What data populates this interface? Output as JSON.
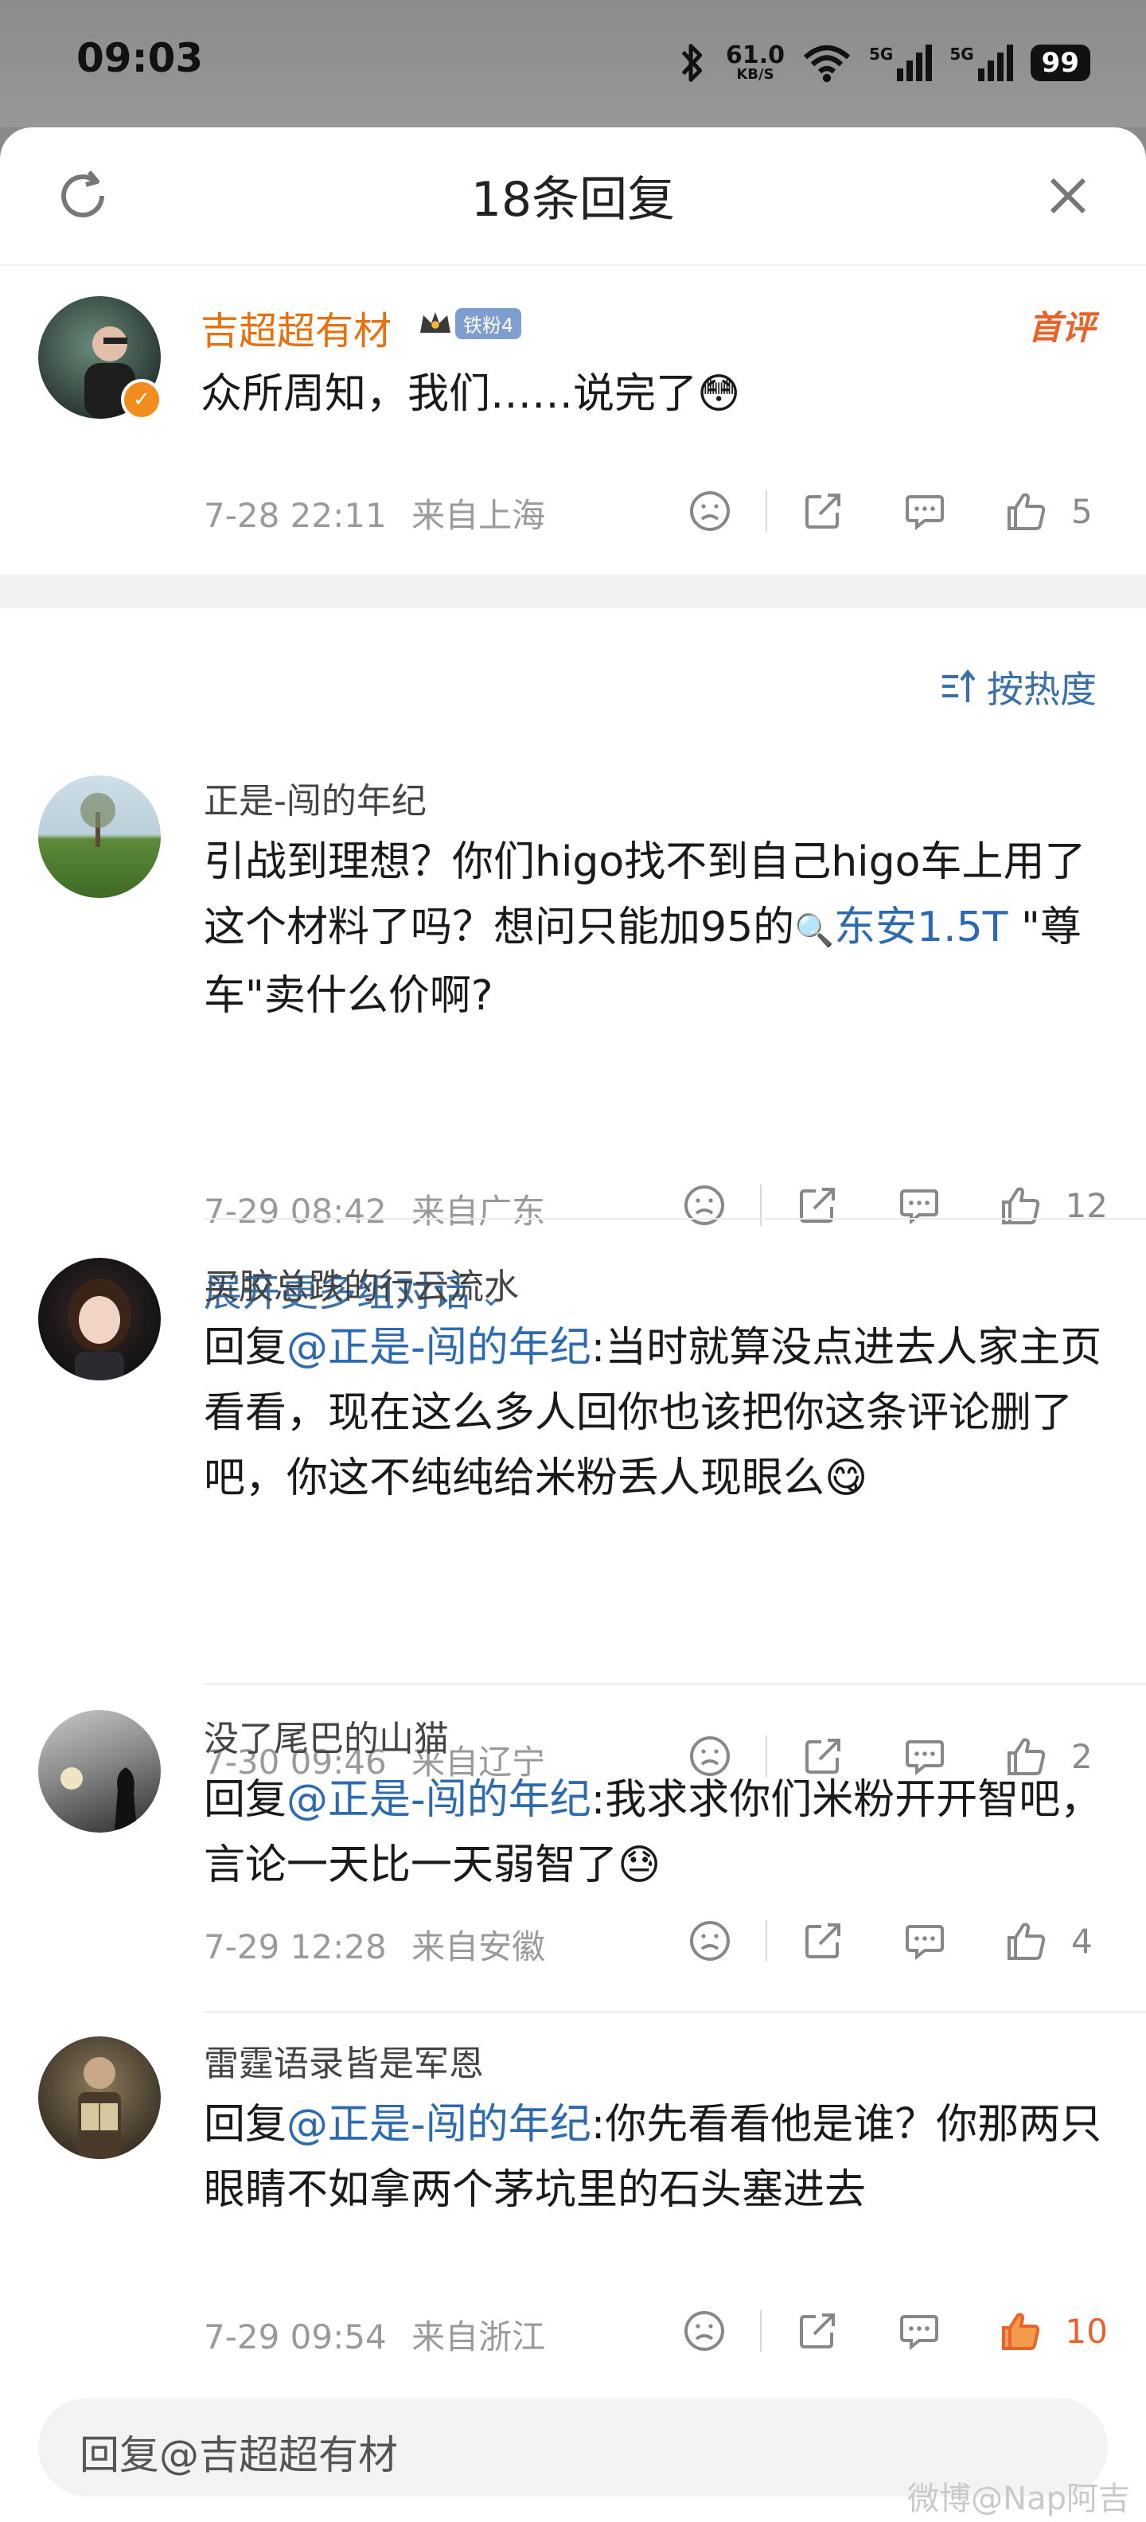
{
  "status": {
    "time": "09:03",
    "net_speed": "61.0",
    "net_unit": "KB/S",
    "signal1": "5G",
    "signal2": "5G",
    "battery": "99"
  },
  "header": {
    "title": "18条回复"
  },
  "root_comment": {
    "user": "吉超超有材",
    "badge": "铁粉4",
    "tag": "首评",
    "text": "众所周知，我们……说完了😳",
    "time": "7-28 22:11",
    "location": "来自上海",
    "likes": "5"
  },
  "sort": {
    "label": "按热度"
  },
  "replies": [
    {
      "user": "正是-闯的年纪",
      "text_a": "引战到理想？你们higo找不到自己higo车上用了这个材料了吗？想问只能加95的",
      "link": "东安1.5T",
      "text_b": " \"尊车\"卖什么价啊?",
      "time": "7-29 08:42",
      "location": "来自广东",
      "likes": "12",
      "expand": "展开更多组对话"
    },
    {
      "user": "买胶总跌的行云流水",
      "reply_prefix": "回复",
      "mention": "@正是-闯的年纪",
      "text": ":当时就算没点进去人家主页看看，现在这么多人回你也该把你这条评论删了吧，你这不纯纯给米粉丢人现眼么😋",
      "time": "7-30 09:46",
      "location": "来自辽宁",
      "likes": "2"
    },
    {
      "user": "没了尾巴的山猫",
      "reply_prefix": "回复",
      "mention": "@正是-闯的年纪",
      "text": ":我求求你们米粉开开智吧，言论一天比一天弱智了😓",
      "time": "7-29 12:28",
      "location": "来自安徽",
      "likes": "4"
    },
    {
      "user": "雷霆语录皆是军恩",
      "reply_prefix": "回复",
      "mention": "@正是-闯的年纪",
      "text": ":你先看看他是谁？你那两只眼睛不如拿两个茅坑里的石头塞进去",
      "time": "7-29 09:54",
      "location": "来自浙江",
      "likes": "10"
    }
  ],
  "reply_input": {
    "placeholder": "回复@吉超超有材"
  },
  "watermark": "微博@Nap阿吉",
  "colors": {
    "accent": "#2d6ab0",
    "username_highlight": "#e8700d",
    "like_active": "#e8632a"
  }
}
